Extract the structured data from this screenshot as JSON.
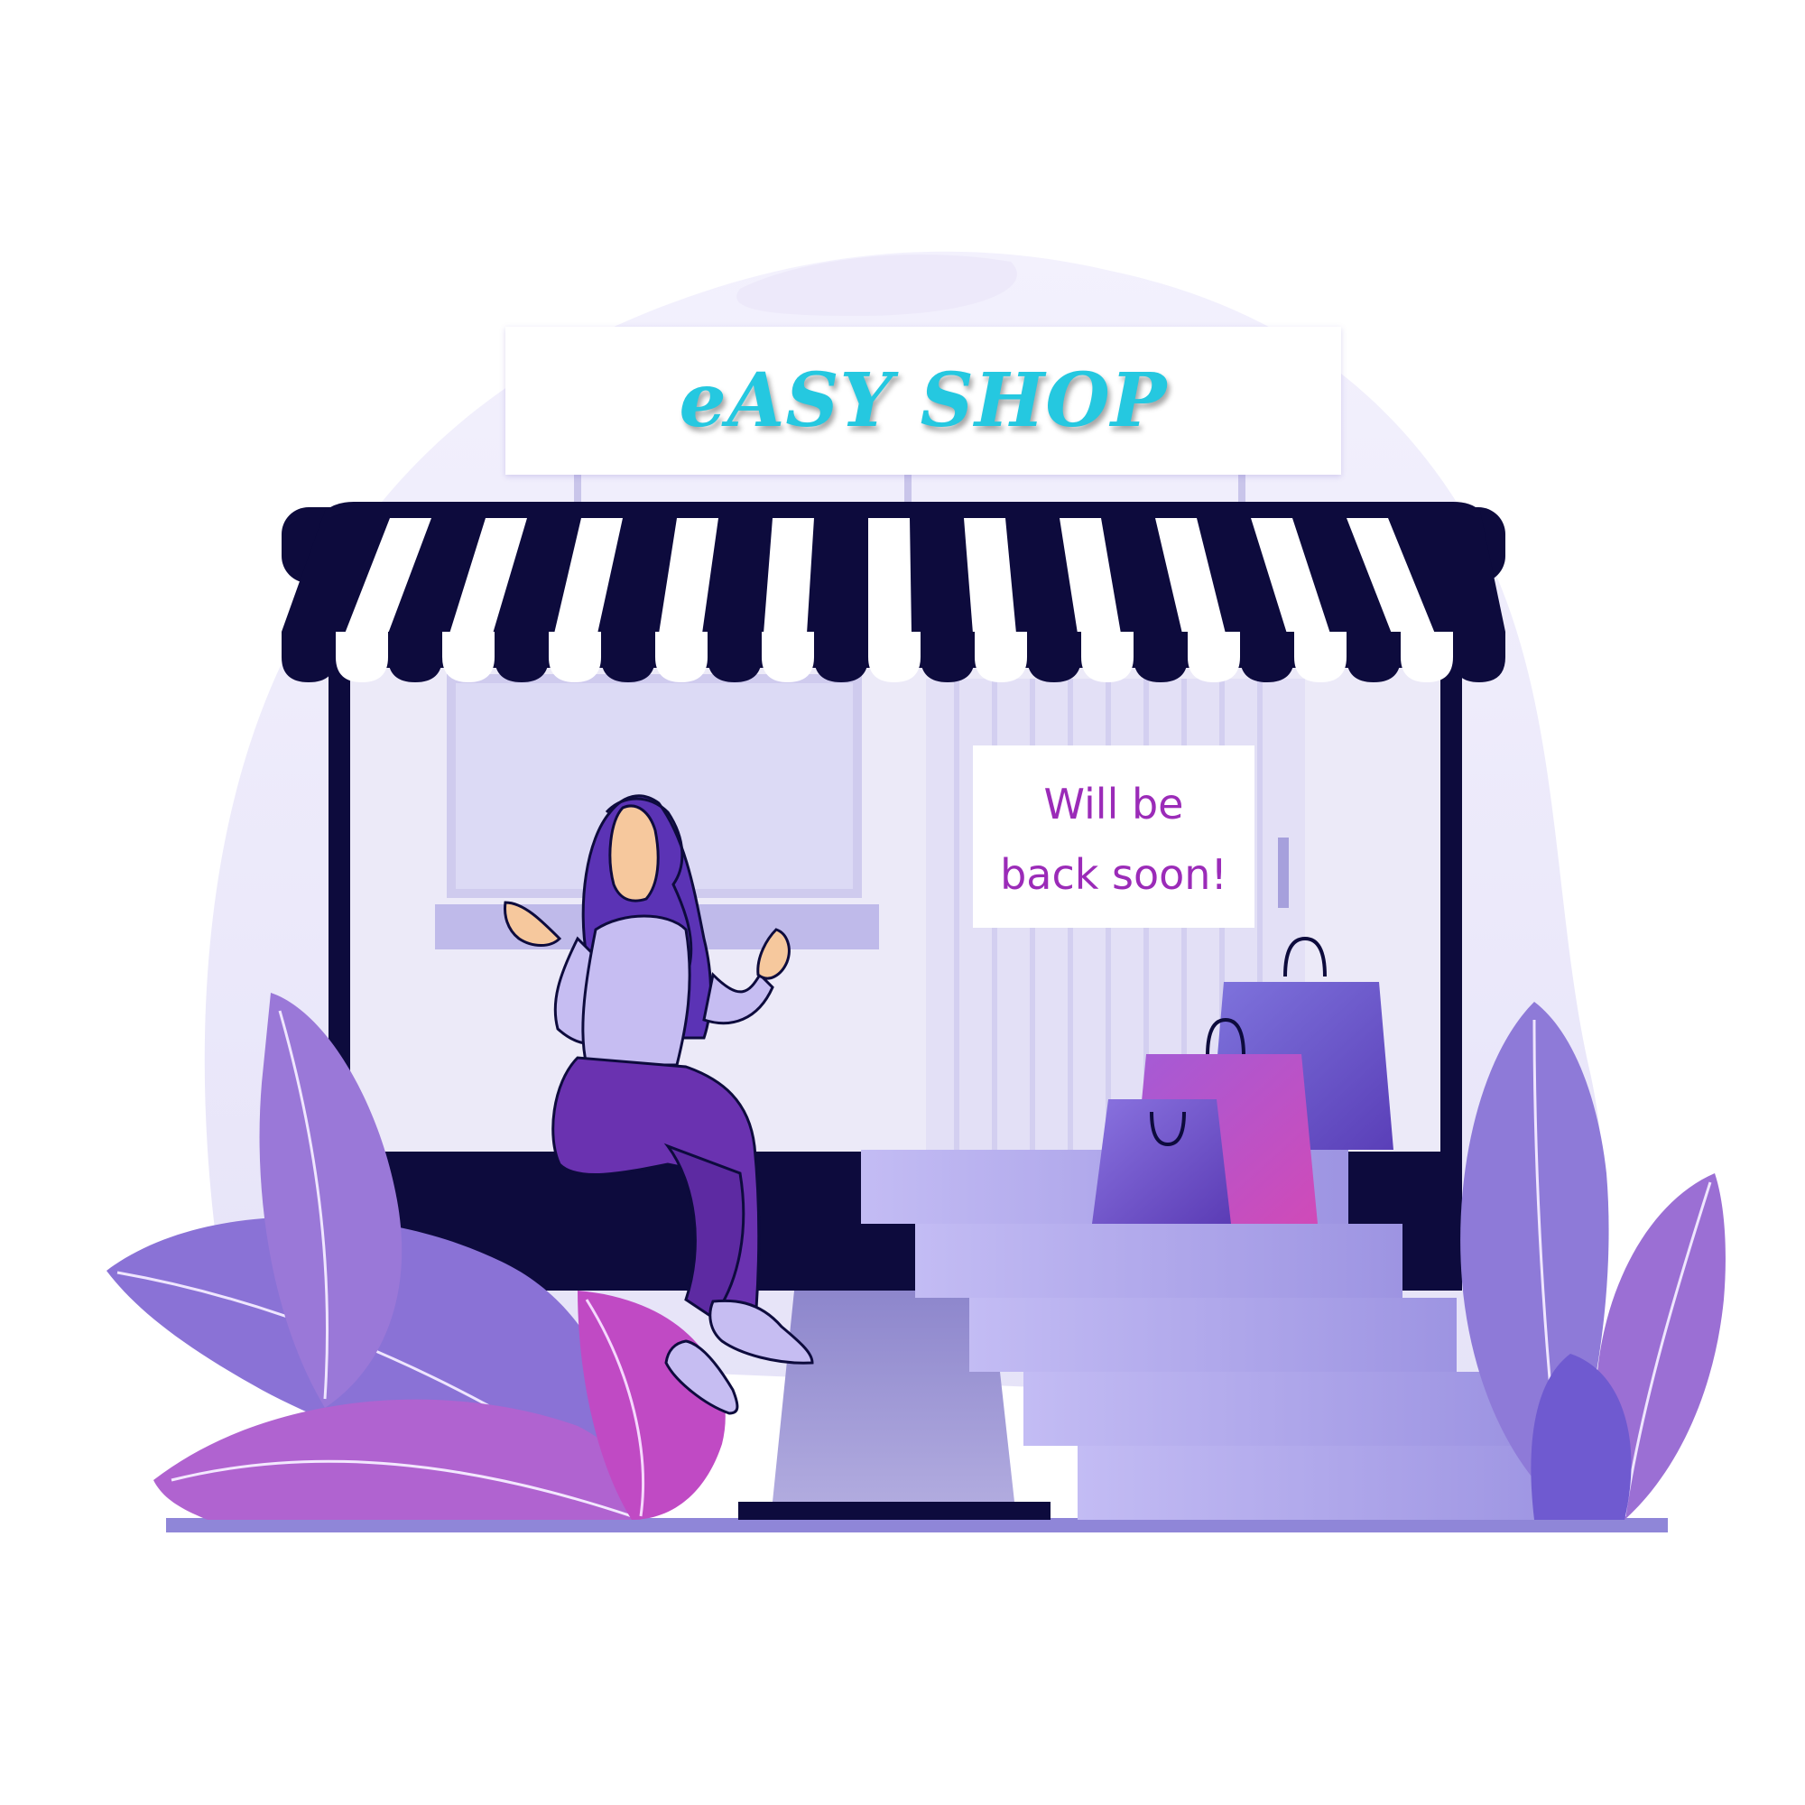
{
  "sign": {
    "title": "eASY SHOP"
  },
  "notice": {
    "line1": "Will be",
    "line2": "back soon!"
  },
  "colors": {
    "sign_text": "#25c8e0",
    "notice_text": "#9b2bb8",
    "awning_dark": "#0d0b3d",
    "awning_light": "#ffffff",
    "shop_frame": "#0d0b3d",
    "window": "#dcdaf5",
    "stairs": "#b7aef0",
    "leaf_purple": "#8e63d4",
    "leaf_magenta": "#c04ac4",
    "ground": "#8f86d8"
  },
  "icons": [
    "shopping-bag-icon",
    "leaf-icon"
  ]
}
